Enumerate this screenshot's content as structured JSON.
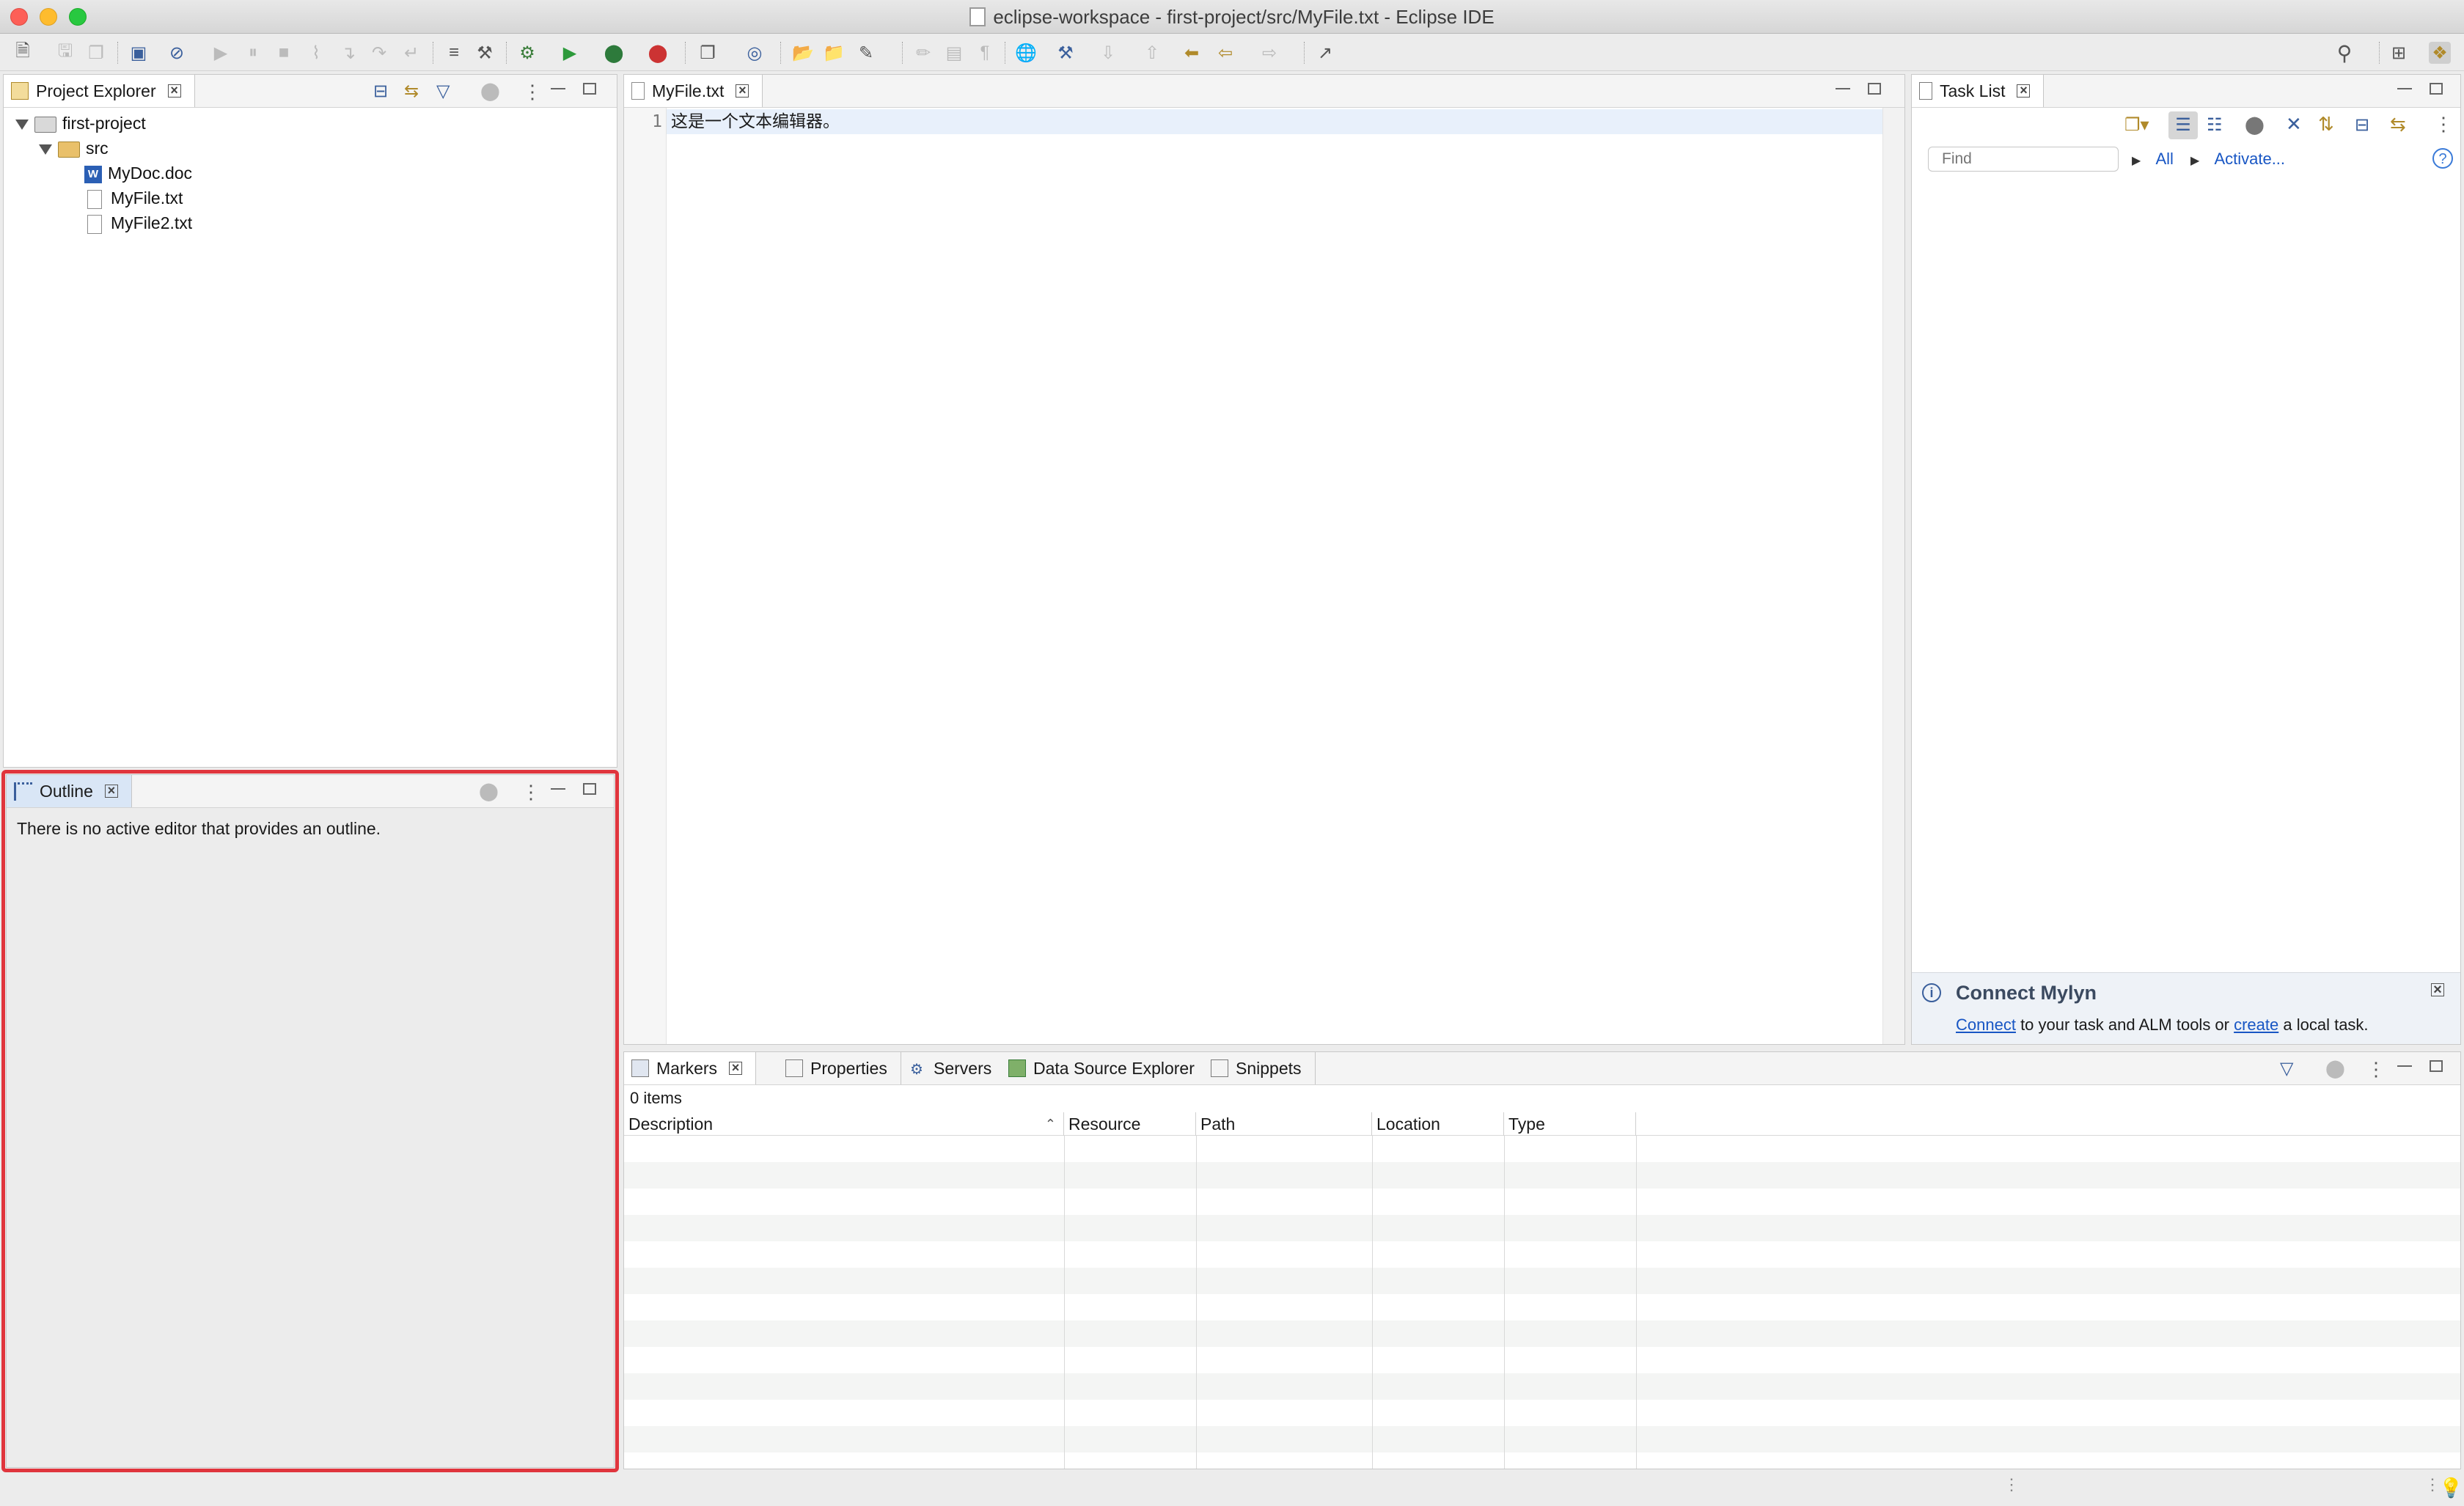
{
  "window": {
    "title": "eclipse-workspace - first-project/src/MyFile.txt - Eclipse IDE"
  },
  "project_explorer": {
    "tab_label": "Project Explorer",
    "tree": {
      "project": "first-project",
      "folder": "src",
      "files": [
        "MyDoc.doc",
        "MyFile.txt",
        "MyFile2.txt"
      ]
    }
  },
  "outline": {
    "tab_label": "Outline",
    "message": "There is no active editor that provides an outline."
  },
  "editor": {
    "tab_label": "MyFile.txt",
    "line_number": "1",
    "line_text": "这是一个文本编辑器。"
  },
  "task_list": {
    "tab_label": "Task List",
    "find_placeholder": "Find",
    "all_label": "All",
    "activate_label": "Activate...",
    "help_icon": "?",
    "connect_title": "Connect Mylyn",
    "connect_link": "Connect",
    "connect_middle": " to your task and ALM tools or ",
    "create_link": "create",
    "connect_end": " a local task."
  },
  "bottom_tabs": {
    "markers": "Markers",
    "properties": "Properties",
    "servers": "Servers",
    "data_source_explorer": "Data Source Explorer",
    "snippets": "Snippets"
  },
  "markers": {
    "count": "0 items",
    "columns": [
      "Description",
      "Resource",
      "Path",
      "Location",
      "Type"
    ]
  },
  "colors": {
    "highlight_border": "#e0353d",
    "link": "#1856c4",
    "selection_line": "#e8f0fb"
  }
}
